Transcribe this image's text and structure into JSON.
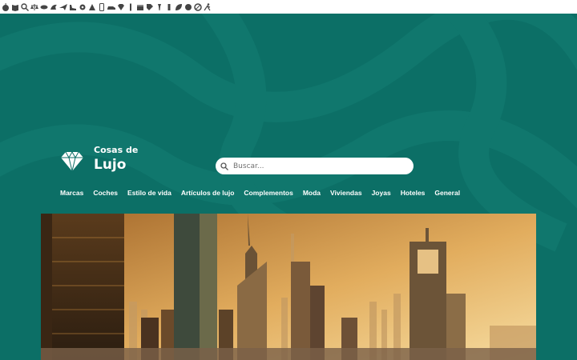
{
  "toolbar_icons": [
    "apple-icon",
    "book-icon",
    "search-icon",
    "scales-icon",
    "lips-icon",
    "dragon-icon",
    "airplane-icon",
    "shoe-icon",
    "gear-icon",
    "cloak-icon",
    "phone-icon",
    "car-icon",
    "diamond-icon",
    "bottle-icon",
    "clapperboard-icon",
    "tag-icon",
    "torch-icon",
    "tall-glass-icon",
    "leaf-icon",
    "cake-icon",
    "plate-icon",
    "runner-icon"
  ],
  "site": {
    "logo_line1": "Cosas de",
    "logo_line2": "Lujo"
  },
  "search": {
    "placeholder": "Buscar..."
  },
  "nav": {
    "items": [
      "Marcas",
      "Coches",
      "Estilo de vida",
      "Artículos de lujo",
      "Complementos",
      "Moda",
      "Viviendas",
      "Joyas",
      "Hoteles",
      "General"
    ]
  },
  "colors": {
    "hero_bg": "#0c6f66",
    "accent": "#ffffff",
    "sky_top": "#d79a4a",
    "sky_bottom": "#f3d08a"
  }
}
